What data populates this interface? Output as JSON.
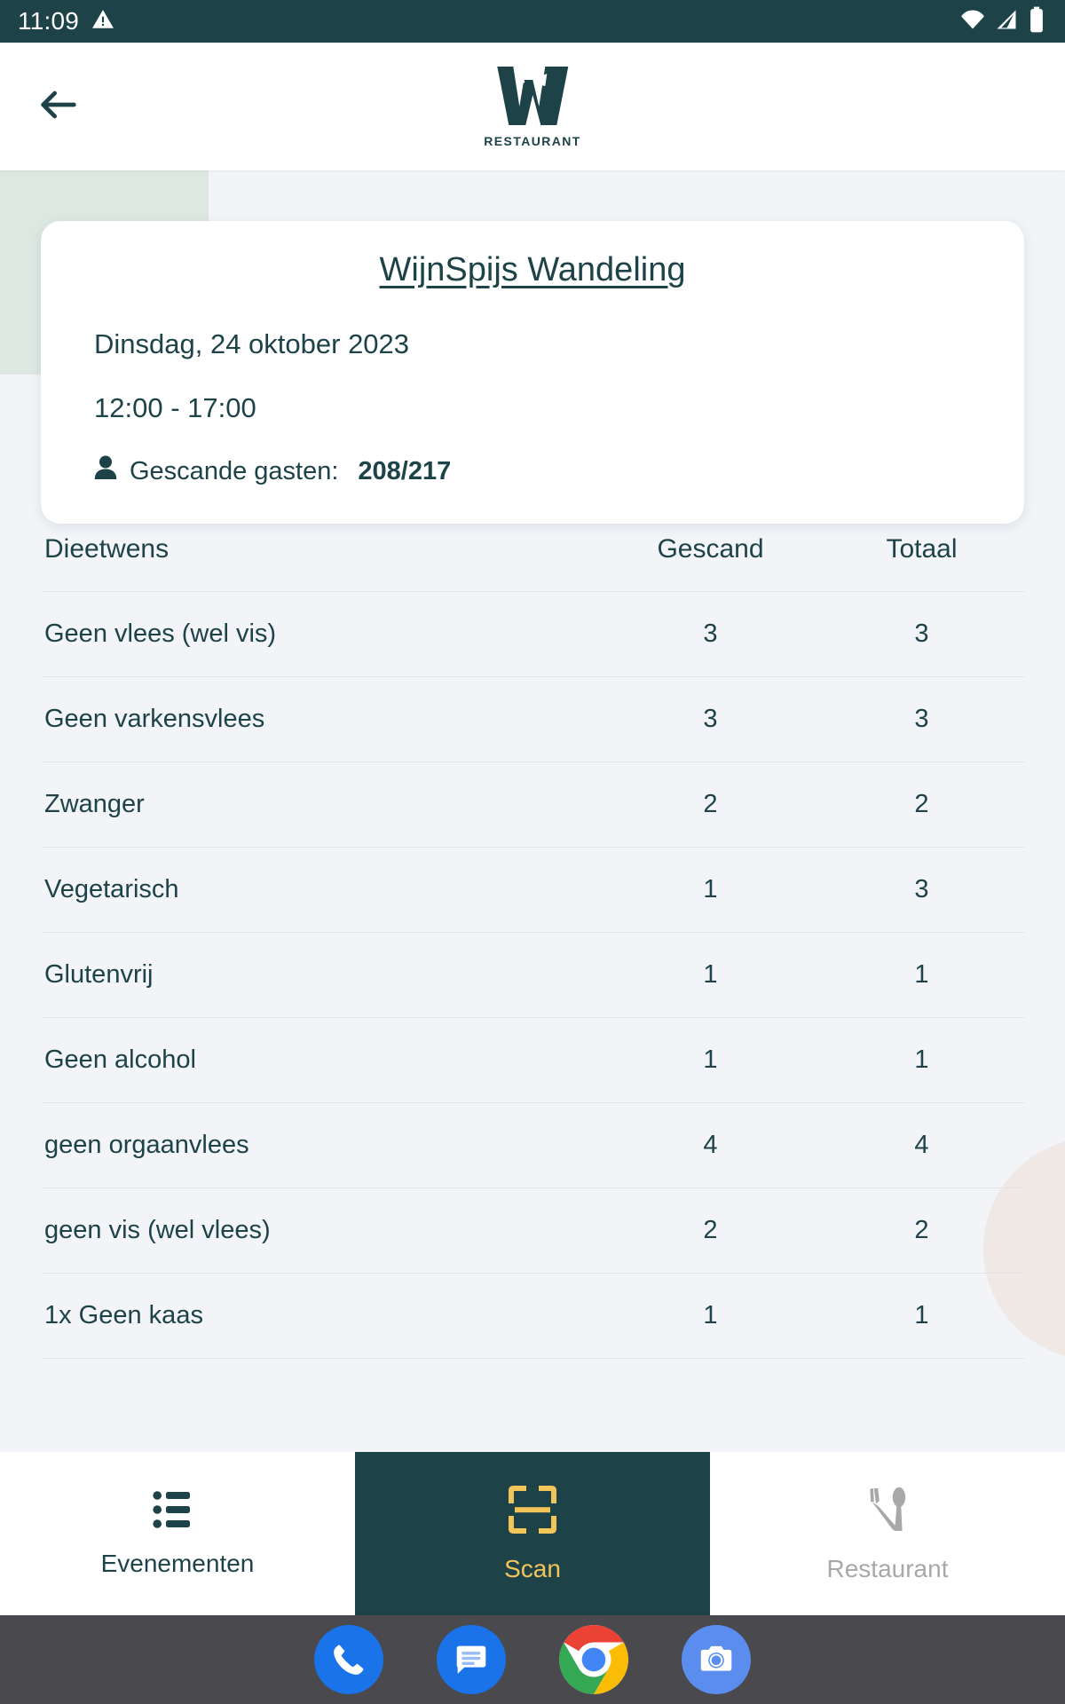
{
  "status_bar": {
    "time": "11:09",
    "icons": [
      "warning-triangle-icon",
      "wifi-icon",
      "signal-icon",
      "battery-icon"
    ]
  },
  "app_bar": {
    "back_label": "back-arrow-icon",
    "brand_mark": "W",
    "brand_word": "RESTAURANT"
  },
  "event_card": {
    "title": "WijnSpijs Wandeling",
    "date": "Dinsdag, 24 oktober 2023",
    "time_range": "12:00 - 17:00",
    "guests_label": "Gescande gasten:",
    "guests_count": "208/217"
  },
  "diet_table": {
    "columns": [
      "Dieetwens",
      "Gescand",
      "Totaal"
    ],
    "rows": [
      {
        "name": "Geen vlees (wel vis)",
        "scanned": "3",
        "total": "3"
      },
      {
        "name": "Geen varkensvlees",
        "scanned": "3",
        "total": "3"
      },
      {
        "name": "Zwanger",
        "scanned": "2",
        "total": "2"
      },
      {
        "name": "Vegetarisch",
        "scanned": "1",
        "total": "3"
      },
      {
        "name": "Glutenvrij",
        "scanned": "1",
        "total": "1"
      },
      {
        "name": "Geen alcohol",
        "scanned": "1",
        "total": "1"
      },
      {
        "name": "geen orgaanvlees",
        "scanned": "4",
        "total": "4"
      },
      {
        "name": "geen vis (wel vlees)",
        "scanned": "2",
        "total": "2"
      },
      {
        "name": "1x Geen kaas",
        "scanned": "1",
        "total": "1"
      }
    ]
  },
  "bottom_nav": {
    "items": [
      {
        "label": "Evenementen",
        "icon": "list-icon",
        "active": false
      },
      {
        "label": "Scan",
        "icon": "qr-scan-icon",
        "active": true
      },
      {
        "label": "Restaurant",
        "icon": "cutlery-icon",
        "active": false
      }
    ]
  },
  "dock": {
    "apps": [
      "phone-icon",
      "messages-icon",
      "chrome-icon",
      "camera-icon"
    ]
  },
  "colors": {
    "brand_dark": "#1d4348",
    "accent_amber": "#f2c45a",
    "page_bg": "#f2f4f8",
    "deco_green": "#dde8e2",
    "deco_peach": "#f0e8e4",
    "muted_grey": "#a8a8a8"
  }
}
